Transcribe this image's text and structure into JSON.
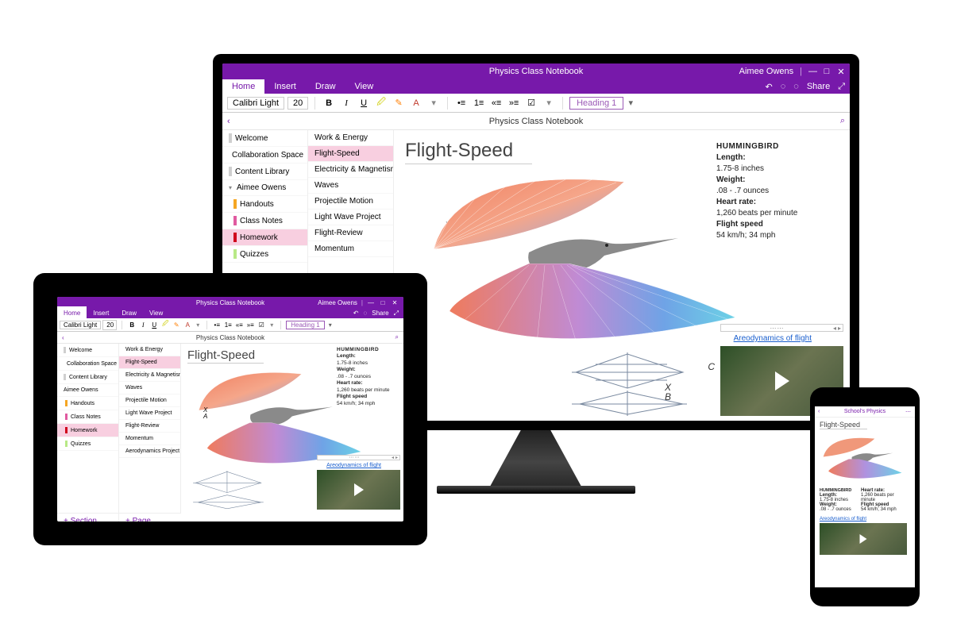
{
  "app": {
    "title": "Physics Class Notebook",
    "user": "Aimee Owens"
  },
  "window": {
    "share": "Share",
    "minimize": "—",
    "maximize": "□",
    "close": "✕"
  },
  "tabs": {
    "home": "Home",
    "insert": "Insert",
    "draw": "Draw",
    "view": "View"
  },
  "ribbon": {
    "font": "Calibri Light",
    "size": "20",
    "heading": "Heading 1"
  },
  "nav": {
    "title": "Physics Class Notebook"
  },
  "sections": [
    {
      "label": "Welcome",
      "color": "#cfcfcf"
    },
    {
      "label": "Collaboration Space",
      "color": "#cfcfcf"
    },
    {
      "label": "Content Library",
      "color": "#cfcfcf"
    },
    {
      "label": "Aimee Owens",
      "color": "#cfcfcf",
      "expanded": true
    },
    {
      "label": "Handouts",
      "color": "#f5a623"
    },
    {
      "label": "Class Notes",
      "color": "#e05aa0"
    },
    {
      "label": "Homework",
      "color": "#d0021b",
      "selected": true
    },
    {
      "label": "Quizzes",
      "color": "#b8e986"
    }
  ],
  "pages": [
    {
      "label": "Work & Energy"
    },
    {
      "label": "Flight-Speed",
      "selected": true
    },
    {
      "label": "Electricity & Magnetism"
    },
    {
      "label": "Waves"
    },
    {
      "label": "Projectile Motion"
    },
    {
      "label": "Light Wave Project"
    },
    {
      "label": "Flight-Review"
    },
    {
      "label": "Momentum"
    },
    {
      "label": "Aerodynamics Project"
    }
  ],
  "page": {
    "title": "Flight-Speed"
  },
  "info": {
    "heading": "HUMMINGBIRD",
    "length_lbl": "Length:",
    "length_val": "1.75-8 inches",
    "weight_lbl": "Weight:",
    "weight_val": ".08 - .7 ounces",
    "heart_lbl": "Heart rate:",
    "heart_val": "1,260 beats per minute",
    "speed_lbl": "Flight speed",
    "speed_val": "54 km/h; 34 mph"
  },
  "video": {
    "link": "Areodynamics of flight"
  },
  "annotations": {
    "xa": "X",
    "a": "A",
    "xb": "X",
    "b": "B",
    "c": "C"
  },
  "add": {
    "section": "+  Section",
    "page": "+  Page"
  },
  "phone": {
    "header": "School's Physics",
    "back": "‹"
  }
}
